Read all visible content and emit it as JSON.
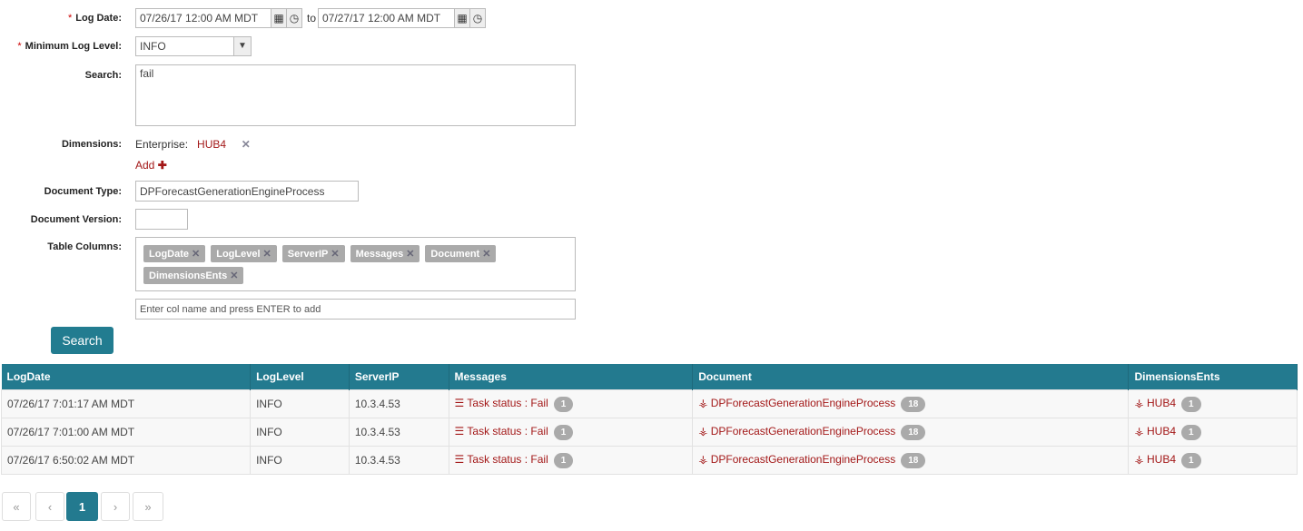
{
  "form": {
    "log_date": {
      "label": "Log Date:",
      "from": "07/26/17 12:00 AM MDT",
      "to_label": "to",
      "to": "07/27/17 12:00 AM MDT"
    },
    "min_level": {
      "label": "Minimum Log Level:",
      "value": "INFO"
    },
    "search": {
      "label": "Search:",
      "value": "fail"
    },
    "dimensions": {
      "label": "Dimensions:",
      "key": "Enterprise:",
      "value": "HUB4",
      "add_label": "Add"
    },
    "doc_type": {
      "label": "Document Type:",
      "value": "DPForecastGenerationEngineProcess"
    },
    "doc_version": {
      "label": "Document Version:",
      "value": ""
    },
    "table_columns": {
      "label": "Table Columns:",
      "tags": [
        "LogDate",
        "LogLevel",
        "ServerIP",
        "Messages",
        "Document",
        "DimensionsEnts"
      ],
      "placeholder": "Enter col name and press ENTER to add"
    },
    "search_button": "Search"
  },
  "table": {
    "headers": [
      "LogDate",
      "LogLevel",
      "ServerIP",
      "Messages",
      "Document",
      "DimensionsEnts"
    ],
    "rows": [
      {
        "date": "07/26/17 7:01:17 AM MDT",
        "level": "INFO",
        "ip": "10.3.4.53",
        "message": "Task status : Fail",
        "msg_count": "1",
        "document": "DPForecastGenerationEngineProcess",
        "doc_count": "18",
        "dim": "HUB4",
        "dim_count": "1"
      },
      {
        "date": "07/26/17 7:01:00 AM MDT",
        "level": "INFO",
        "ip": "10.3.4.53",
        "message": "Task status : Fail",
        "msg_count": "1",
        "document": "DPForecastGenerationEngineProcess",
        "doc_count": "18",
        "dim": "HUB4",
        "dim_count": "1"
      },
      {
        "date": "07/26/17 6:50:02 AM MDT",
        "level": "INFO",
        "ip": "10.3.4.53",
        "message": "Task status : Fail",
        "msg_count": "1",
        "document": "DPForecastGenerationEngineProcess",
        "doc_count": "18",
        "dim": "HUB4",
        "dim_count": "1"
      }
    ]
  },
  "pagination": {
    "first": "«",
    "prev": "‹",
    "current": "1",
    "next": "›",
    "last": "»"
  },
  "colors": {
    "accent": "#237a8f",
    "link": "#a31818"
  }
}
